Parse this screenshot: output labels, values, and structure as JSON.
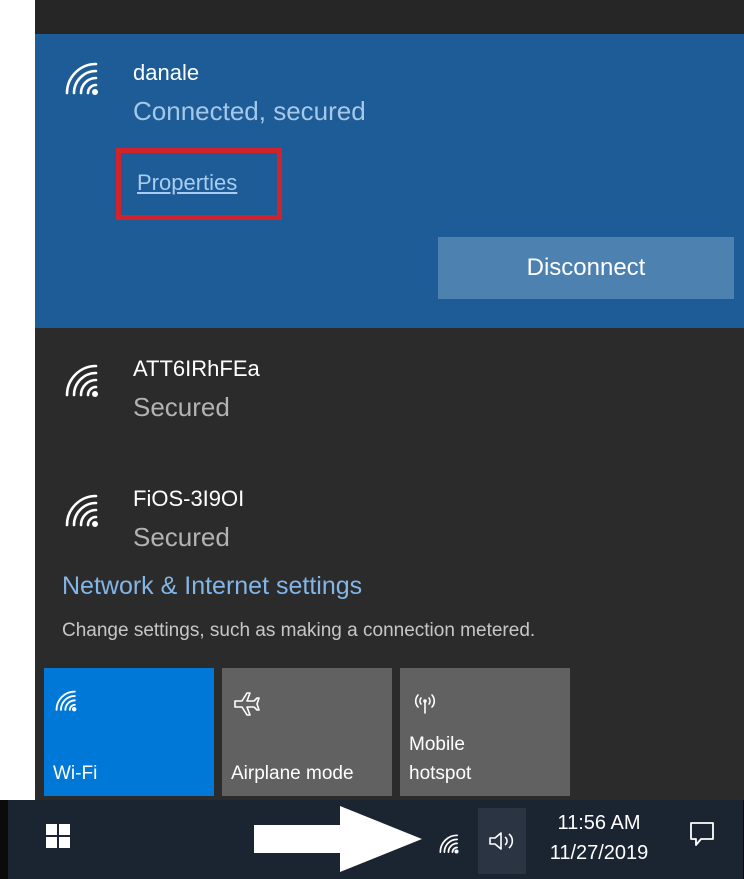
{
  "connected_network": {
    "name": "danale",
    "status": "Connected, secured",
    "properties_label": "Properties",
    "disconnect_label": "Disconnect"
  },
  "networks": [
    {
      "name": "ATT6IRhFEa",
      "status": "Secured"
    },
    {
      "name": "FiOS-3I9OI",
      "status": "Secured"
    }
  ],
  "settings": {
    "link": "Network & Internet settings",
    "description": "Change settings, such as making a connection metered."
  },
  "quick_actions": [
    {
      "label": "Wi-Fi",
      "icon": "wifi-icon",
      "active": true
    },
    {
      "label": "Airplane mode",
      "icon": "airplane-icon",
      "active": false
    },
    {
      "label": "Mobile hotspot",
      "icon": "hotspot-icon",
      "active": false
    }
  ],
  "taskbar": {
    "time": "11:56 AM",
    "date": "11/27/2019"
  },
  "colors": {
    "accent": "#0078d7",
    "connected_bg": "#1d5c96",
    "flyout_bg": "#2b2b2b",
    "highlight": "#d1232b"
  }
}
